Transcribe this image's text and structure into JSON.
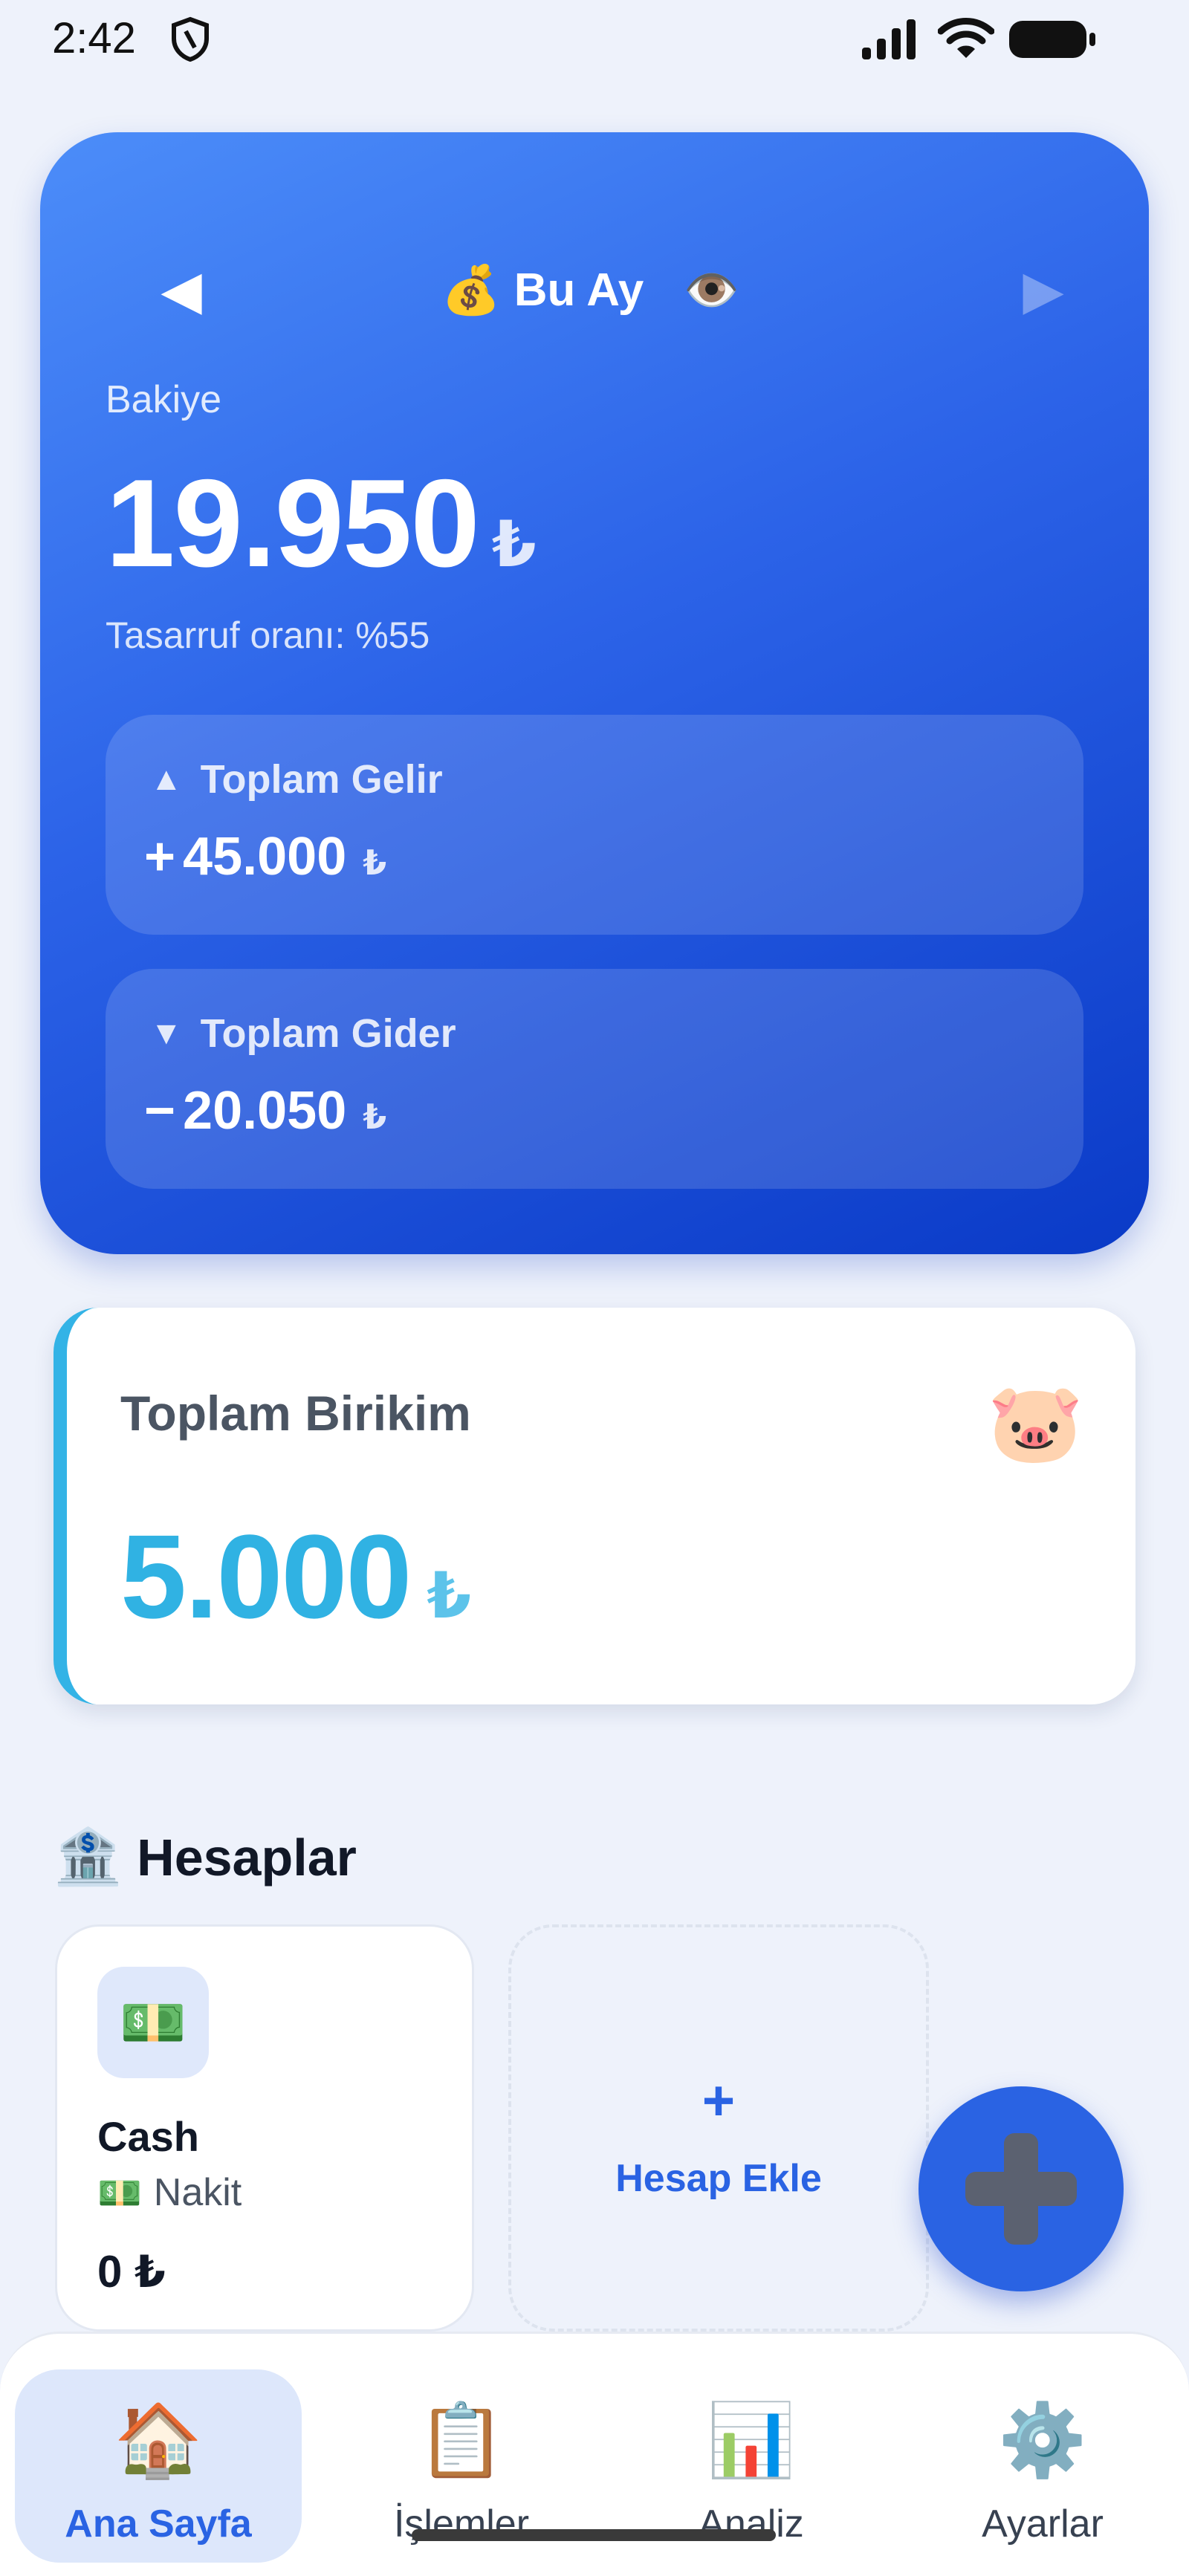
{
  "status_bar": {
    "time": "2:42"
  },
  "balance_card": {
    "period_emoji": "💰",
    "period_label": "Bu Ay",
    "prev_glyph": "◀",
    "next_glyph": "▶",
    "eye_emoji": "👁️",
    "balance_label": "Bakiye",
    "balance_amount": "19.950",
    "currency": "₺",
    "savings_rate": "Tasarruf oranı: %55",
    "income": {
      "arrow": "▲",
      "title": "Toplam Gelir",
      "sign": "+",
      "value": "45.000"
    },
    "expense": {
      "arrow": "▼",
      "title": "Toplam Gider",
      "sign": "−",
      "value": "20.050"
    }
  },
  "savings_card": {
    "title": "Toplam Birikim",
    "emoji": "🐷",
    "amount": "5.000",
    "currency": "₺"
  },
  "accounts": {
    "icon_emoji": "🏦",
    "title": "Hesaplar",
    "items": [
      {
        "icon_emoji": "💵",
        "name": "Cash",
        "type_emoji": "💵",
        "type": "Nakit",
        "balance": "0 ₺"
      }
    ],
    "add_plus": "+",
    "add_label": "Hesap Ekle"
  },
  "bottom_nav": {
    "items": [
      {
        "emoji": "🏠",
        "label": "Ana Sayfa"
      },
      {
        "emoji": "📋",
        "label": "İşlemler"
      },
      {
        "emoji": "📊",
        "label": "Analiz"
      },
      {
        "emoji": "⚙️",
        "label": "Ayarlar"
      }
    ]
  },
  "colors": {
    "accent": "#2a63e3",
    "savings": "#30b2e3",
    "background": "#eef2fb"
  },
  "icons": [
    "shield-icon",
    "signal-icon",
    "wifi-icon",
    "battery-icon",
    "eye-icon",
    "pig-icon",
    "bank-icon",
    "fab-plus-icon"
  ]
}
